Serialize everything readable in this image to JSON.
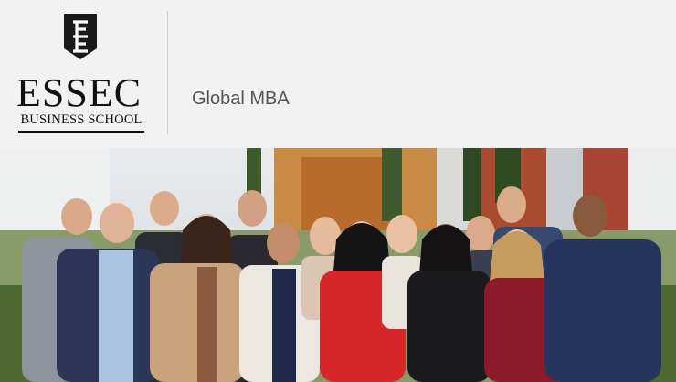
{
  "brand": {
    "shield_letter": "E",
    "wordmark": "ESSEC",
    "school_name": "BUSINESS SCHOOL",
    "shield_color": "#1a1a1a"
  },
  "program": {
    "title": "Global MBA"
  },
  "photo": {
    "subject": "group of students",
    "people_count": 16
  }
}
